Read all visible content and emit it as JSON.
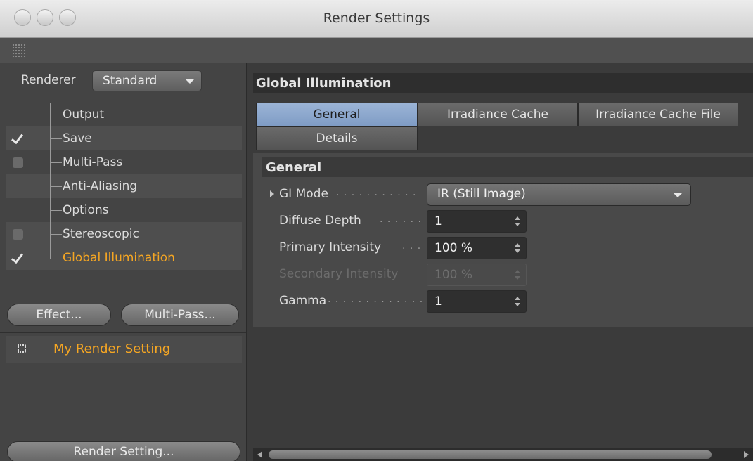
{
  "window": {
    "title": "Render Settings"
  },
  "left_panel": {
    "renderer_label": "Renderer",
    "renderer_value": "Standard",
    "tree": [
      {
        "label": "Output",
        "check": "none",
        "active": false
      },
      {
        "label": "Save",
        "check": "on",
        "active": false
      },
      {
        "label": "Multi-Pass",
        "check": "off",
        "active": false
      },
      {
        "label": "Anti-Aliasing",
        "check": "none",
        "active": false
      },
      {
        "label": "Options",
        "check": "none",
        "active": false
      },
      {
        "label": "Stereoscopic",
        "check": "off",
        "active": false
      },
      {
        "label": "Global Illumination",
        "check": "on",
        "active": true
      }
    ],
    "effect_button": "Effect...",
    "multipass_button": "Multi-Pass...",
    "render_setting_item": "My Render Setting",
    "render_setting_button": "Render Setting..."
  },
  "right_panel": {
    "section_title": "Global Illumination",
    "tabs": [
      {
        "label": "General",
        "selected": true
      },
      {
        "label": "Irradiance Cache",
        "selected": false
      },
      {
        "label": "Irradiance Cache File",
        "selected": false
      },
      {
        "label": "Details",
        "selected": false
      }
    ],
    "sub_section_title": "General",
    "params": {
      "gi_mode": {
        "label": "GI Mode",
        "value": "IR (Still Image)"
      },
      "diffuse_depth": {
        "label": "Diffuse Depth",
        "value": "1"
      },
      "primary_intensity": {
        "label": "Primary Intensity",
        "value": "100 %"
      },
      "secondary_intensity": {
        "label": "Secondary Intensity",
        "value": "100 %",
        "disabled": true
      },
      "gamma": {
        "label": "Gamma",
        "value": "1"
      }
    }
  },
  "colors": {
    "accent_orange": "#f5a623",
    "selected_tab": "#8fa9cf",
    "panel_bg": "#444444"
  }
}
